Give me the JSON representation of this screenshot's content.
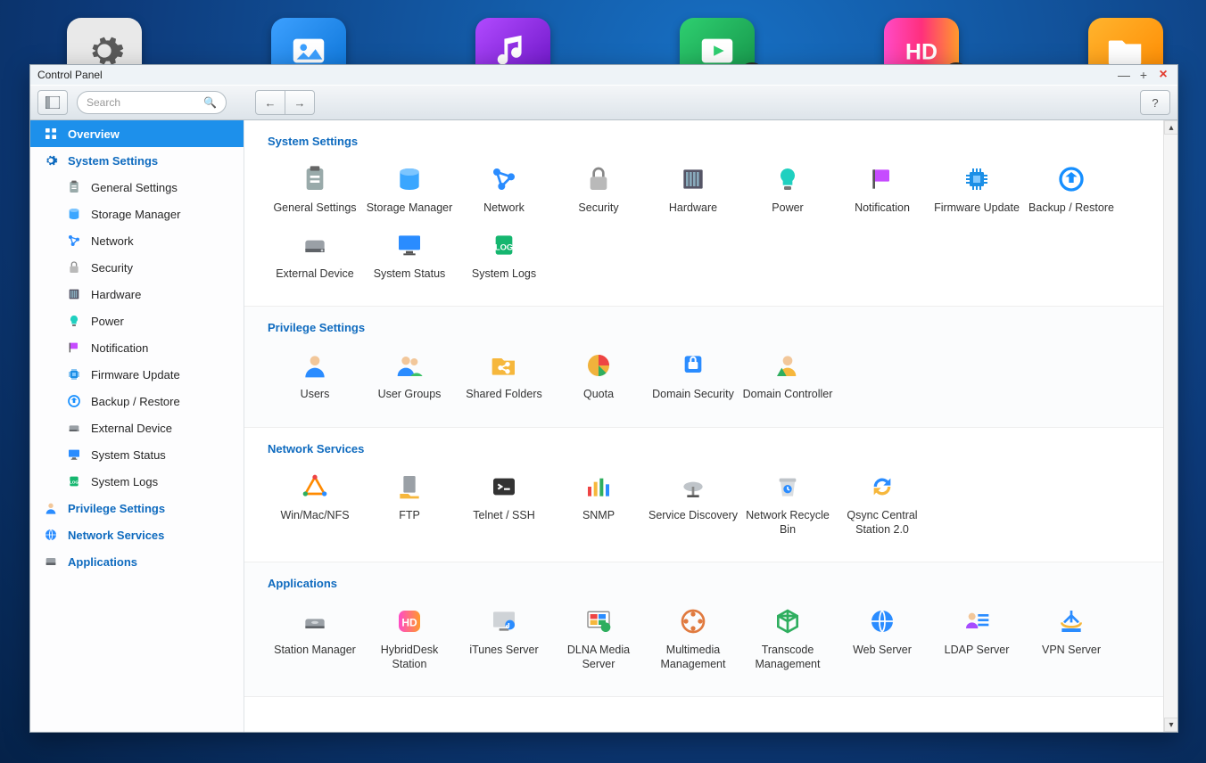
{
  "window": {
    "title": "Control Panel"
  },
  "toolbar": {
    "search_placeholder": "Search"
  },
  "dock": [
    {
      "name": "settings",
      "title": "Control Panel"
    },
    {
      "name": "photos",
      "title": "Photo Station"
    },
    {
      "name": "music",
      "title": "Music Station"
    },
    {
      "name": "video",
      "title": "Video Station",
      "download_badge": true
    },
    {
      "name": "hd",
      "title": "HD Station",
      "download_badge": true
    },
    {
      "name": "files",
      "title": "File Station"
    }
  ],
  "sidebar": [
    {
      "type": "section",
      "key": "overview",
      "label": "Overview",
      "selected": true,
      "icon": "grid"
    },
    {
      "type": "section",
      "key": "system",
      "label": "System Settings",
      "icon": "gear"
    },
    {
      "type": "child",
      "key": "general",
      "label": "General Settings",
      "icon": "clipboard"
    },
    {
      "type": "child",
      "key": "storage",
      "label": "Storage Manager",
      "icon": "disk"
    },
    {
      "type": "child",
      "key": "network",
      "label": "Network",
      "icon": "net"
    },
    {
      "type": "child",
      "key": "security",
      "label": "Security",
      "icon": "lock"
    },
    {
      "type": "child",
      "key": "hardware",
      "label": "Hardware",
      "icon": "server"
    },
    {
      "type": "child",
      "key": "power",
      "label": "Power",
      "icon": "bulb"
    },
    {
      "type": "child",
      "key": "notification",
      "label": "Notification",
      "icon": "flag"
    },
    {
      "type": "child",
      "key": "firmware",
      "label": "Firmware Update",
      "icon": "chip"
    },
    {
      "type": "child",
      "key": "backup",
      "label": "Backup / Restore",
      "icon": "restore"
    },
    {
      "type": "child",
      "key": "extdev",
      "label": "External Device",
      "icon": "drive"
    },
    {
      "type": "child",
      "key": "status",
      "label": "System Status",
      "icon": "monitor"
    },
    {
      "type": "child",
      "key": "logs",
      "label": "System Logs",
      "icon": "log"
    },
    {
      "type": "section",
      "key": "privilege",
      "label": "Privilege Settings",
      "icon": "user"
    },
    {
      "type": "section",
      "key": "netsvc",
      "label": "Network Services",
      "icon": "globe"
    },
    {
      "type": "section",
      "key": "apps",
      "label": "Applications",
      "icon": "drive2"
    }
  ],
  "sections": [
    {
      "key": "system",
      "title": "System Settings",
      "items": [
        {
          "key": "general",
          "label": "General Settings",
          "icon": "clipboard"
        },
        {
          "key": "storage",
          "label": "Storage Manager",
          "icon": "disk"
        },
        {
          "key": "network",
          "label": "Network",
          "icon": "net"
        },
        {
          "key": "security",
          "label": "Security",
          "icon": "lock"
        },
        {
          "key": "hardware",
          "label": "Hardware",
          "icon": "server"
        },
        {
          "key": "power",
          "label": "Power",
          "icon": "bulb"
        },
        {
          "key": "notification",
          "label": "Notification",
          "icon": "flag"
        },
        {
          "key": "firmware",
          "label": "Firmware Update",
          "icon": "chip"
        },
        {
          "key": "backup",
          "label": "Backup / Restore",
          "icon": "restore"
        },
        {
          "key": "extdev",
          "label": "External Device",
          "icon": "drive"
        },
        {
          "key": "status",
          "label": "System Status",
          "icon": "monitor"
        },
        {
          "key": "logs",
          "label": "System Logs",
          "icon": "log"
        }
      ]
    },
    {
      "key": "privilege",
      "title": "Privilege Settings",
      "items": [
        {
          "key": "users",
          "label": "Users",
          "icon": "user"
        },
        {
          "key": "groups",
          "label": "User Groups",
          "icon": "users"
        },
        {
          "key": "shared",
          "label": "Shared Folders",
          "icon": "folder-share"
        },
        {
          "key": "quota",
          "label": "Quota",
          "icon": "pie"
        },
        {
          "key": "domsec",
          "label": "Domain Security",
          "icon": "dom-sec"
        },
        {
          "key": "domctrl",
          "label": "Domain Controller",
          "icon": "dom-ctrl"
        }
      ]
    },
    {
      "key": "netsvc",
      "title": "Network Services",
      "items": [
        {
          "key": "winmac",
          "label": "Win/Mac/NFS",
          "icon": "triangle"
        },
        {
          "key": "ftp",
          "label": "FTP",
          "icon": "ftp"
        },
        {
          "key": "ssh",
          "label": "Telnet / SSH",
          "icon": "terminal"
        },
        {
          "key": "snmp",
          "label": "SNMP",
          "icon": "bars"
        },
        {
          "key": "svcdisc",
          "label": "Service Discovery",
          "icon": "dish"
        },
        {
          "key": "recycle",
          "label": "Network Recycle Bin",
          "icon": "recycle"
        },
        {
          "key": "qsync",
          "label": "Qsync Central Station 2.0",
          "icon": "sync"
        }
      ]
    },
    {
      "key": "apps",
      "title": "Applications",
      "items": [
        {
          "key": "station",
          "label": "Station Manager",
          "icon": "station"
        },
        {
          "key": "hybrid",
          "label": "HybridDesk Station",
          "icon": "hd"
        },
        {
          "key": "itunes",
          "label": "iTunes Server",
          "icon": "itunes"
        },
        {
          "key": "dlna",
          "label": "DLNA Media Server",
          "icon": "dlna"
        },
        {
          "key": "multimedia",
          "label": "Multimedia Management",
          "icon": "reel"
        },
        {
          "key": "transcode",
          "label": "Transcode Management",
          "icon": "cube"
        },
        {
          "key": "web",
          "label": "Web Server",
          "icon": "globe"
        },
        {
          "key": "ldap",
          "label": "LDAP Server",
          "icon": "ldap"
        },
        {
          "key": "vpn",
          "label": "VPN Server",
          "icon": "vpn"
        }
      ]
    }
  ]
}
